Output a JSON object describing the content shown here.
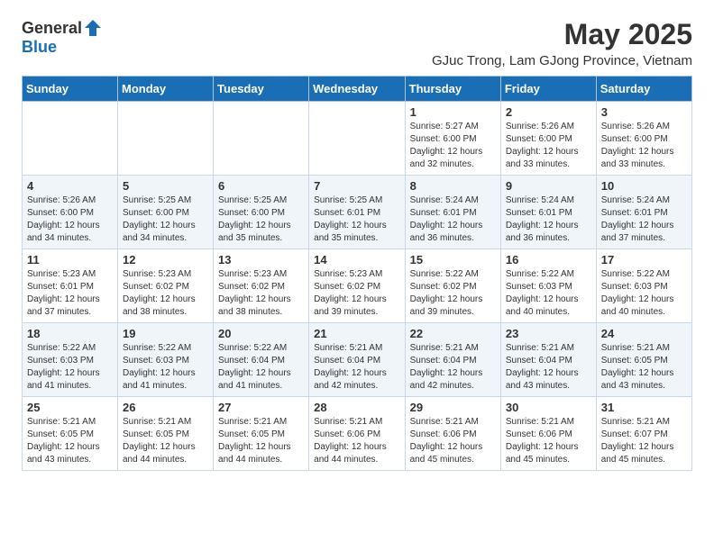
{
  "header": {
    "logo_general": "General",
    "logo_blue": "Blue",
    "title": "May 2025",
    "subtitle": "GJuc Trong, Lam GJong Province, Vietnam"
  },
  "weekdays": [
    "Sunday",
    "Monday",
    "Tuesday",
    "Wednesday",
    "Thursday",
    "Friday",
    "Saturday"
  ],
  "weeks": [
    [
      {
        "day": "",
        "info": ""
      },
      {
        "day": "",
        "info": ""
      },
      {
        "day": "",
        "info": ""
      },
      {
        "day": "",
        "info": ""
      },
      {
        "day": "1",
        "info": "Sunrise: 5:27 AM\nSunset: 6:00 PM\nDaylight: 12 hours\nand 32 minutes."
      },
      {
        "day": "2",
        "info": "Sunrise: 5:26 AM\nSunset: 6:00 PM\nDaylight: 12 hours\nand 33 minutes."
      },
      {
        "day": "3",
        "info": "Sunrise: 5:26 AM\nSunset: 6:00 PM\nDaylight: 12 hours\nand 33 minutes."
      }
    ],
    [
      {
        "day": "4",
        "info": "Sunrise: 5:26 AM\nSunset: 6:00 PM\nDaylight: 12 hours\nand 34 minutes."
      },
      {
        "day": "5",
        "info": "Sunrise: 5:25 AM\nSunset: 6:00 PM\nDaylight: 12 hours\nand 34 minutes."
      },
      {
        "day": "6",
        "info": "Sunrise: 5:25 AM\nSunset: 6:00 PM\nDaylight: 12 hours\nand 35 minutes."
      },
      {
        "day": "7",
        "info": "Sunrise: 5:25 AM\nSunset: 6:01 PM\nDaylight: 12 hours\nand 35 minutes."
      },
      {
        "day": "8",
        "info": "Sunrise: 5:24 AM\nSunset: 6:01 PM\nDaylight: 12 hours\nand 36 minutes."
      },
      {
        "day": "9",
        "info": "Sunrise: 5:24 AM\nSunset: 6:01 PM\nDaylight: 12 hours\nand 36 minutes."
      },
      {
        "day": "10",
        "info": "Sunrise: 5:24 AM\nSunset: 6:01 PM\nDaylight: 12 hours\nand 37 minutes."
      }
    ],
    [
      {
        "day": "11",
        "info": "Sunrise: 5:23 AM\nSunset: 6:01 PM\nDaylight: 12 hours\nand 37 minutes."
      },
      {
        "day": "12",
        "info": "Sunrise: 5:23 AM\nSunset: 6:02 PM\nDaylight: 12 hours\nand 38 minutes."
      },
      {
        "day": "13",
        "info": "Sunrise: 5:23 AM\nSunset: 6:02 PM\nDaylight: 12 hours\nand 38 minutes."
      },
      {
        "day": "14",
        "info": "Sunrise: 5:23 AM\nSunset: 6:02 PM\nDaylight: 12 hours\nand 39 minutes."
      },
      {
        "day": "15",
        "info": "Sunrise: 5:22 AM\nSunset: 6:02 PM\nDaylight: 12 hours\nand 39 minutes."
      },
      {
        "day": "16",
        "info": "Sunrise: 5:22 AM\nSunset: 6:03 PM\nDaylight: 12 hours\nand 40 minutes."
      },
      {
        "day": "17",
        "info": "Sunrise: 5:22 AM\nSunset: 6:03 PM\nDaylight: 12 hours\nand 40 minutes."
      }
    ],
    [
      {
        "day": "18",
        "info": "Sunrise: 5:22 AM\nSunset: 6:03 PM\nDaylight: 12 hours\nand 41 minutes."
      },
      {
        "day": "19",
        "info": "Sunrise: 5:22 AM\nSunset: 6:03 PM\nDaylight: 12 hours\nand 41 minutes."
      },
      {
        "day": "20",
        "info": "Sunrise: 5:22 AM\nSunset: 6:04 PM\nDaylight: 12 hours\nand 41 minutes."
      },
      {
        "day": "21",
        "info": "Sunrise: 5:21 AM\nSunset: 6:04 PM\nDaylight: 12 hours\nand 42 minutes."
      },
      {
        "day": "22",
        "info": "Sunrise: 5:21 AM\nSunset: 6:04 PM\nDaylight: 12 hours\nand 42 minutes."
      },
      {
        "day": "23",
        "info": "Sunrise: 5:21 AM\nSunset: 6:04 PM\nDaylight: 12 hours\nand 43 minutes."
      },
      {
        "day": "24",
        "info": "Sunrise: 5:21 AM\nSunset: 6:05 PM\nDaylight: 12 hours\nand 43 minutes."
      }
    ],
    [
      {
        "day": "25",
        "info": "Sunrise: 5:21 AM\nSunset: 6:05 PM\nDaylight: 12 hours\nand 43 minutes."
      },
      {
        "day": "26",
        "info": "Sunrise: 5:21 AM\nSunset: 6:05 PM\nDaylight: 12 hours\nand 44 minutes."
      },
      {
        "day": "27",
        "info": "Sunrise: 5:21 AM\nSunset: 6:05 PM\nDaylight: 12 hours\nand 44 minutes."
      },
      {
        "day": "28",
        "info": "Sunrise: 5:21 AM\nSunset: 6:06 PM\nDaylight: 12 hours\nand 44 minutes."
      },
      {
        "day": "29",
        "info": "Sunrise: 5:21 AM\nSunset: 6:06 PM\nDaylight: 12 hours\nand 45 minutes."
      },
      {
        "day": "30",
        "info": "Sunrise: 5:21 AM\nSunset: 6:06 PM\nDaylight: 12 hours\nand 45 minutes."
      },
      {
        "day": "31",
        "info": "Sunrise: 5:21 AM\nSunset: 6:07 PM\nDaylight: 12 hours\nand 45 minutes."
      }
    ]
  ]
}
